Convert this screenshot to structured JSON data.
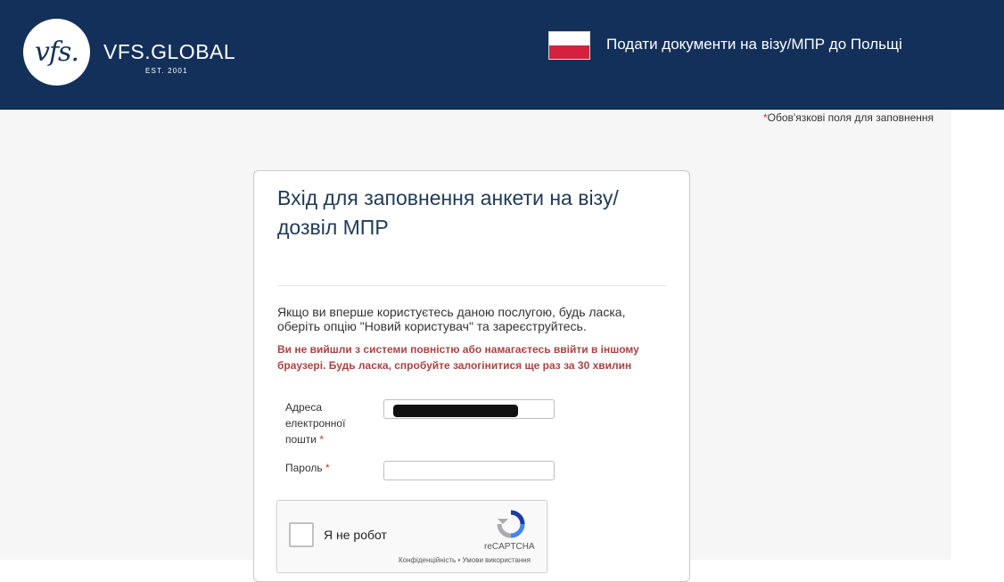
{
  "header": {
    "logo_mark": "vfs.",
    "brand_name": "VFS.GLOBAL",
    "brand_est": "EST. 2001",
    "title": "Подати документи на візу/МПР до Польщі",
    "background": "#13305a",
    "flag_colors": [
      "#ffffff",
      "#d4213d"
    ]
  },
  "required_note": {
    "star": "*",
    "text": "Обов'язкові поля для заповнення"
  },
  "card": {
    "title": "Вхід для заповнення анкети на візу/ дозвіл МПР",
    "info": "Якщо ви вперше  користуєтесь даною послугою, будь ласка, оберіть опцію \"Новий користувач\" та зареєструйтесь.",
    "error": "Ви не вийшли з системи повністю або намагаєтесь ввійти в іншому браузері. Будь ласка, спробуйте залогінитися ще раз за 30 хвилин",
    "error_color": "#a94442",
    "fields": {
      "email_label": "Адреса електронної пошти",
      "password_label": "Пароль",
      "required_star": "*"
    }
  },
  "captcha": {
    "label": "Я не робот",
    "brand": "reCAPTCHA",
    "links": "Конфіденційність • Умови використання"
  }
}
